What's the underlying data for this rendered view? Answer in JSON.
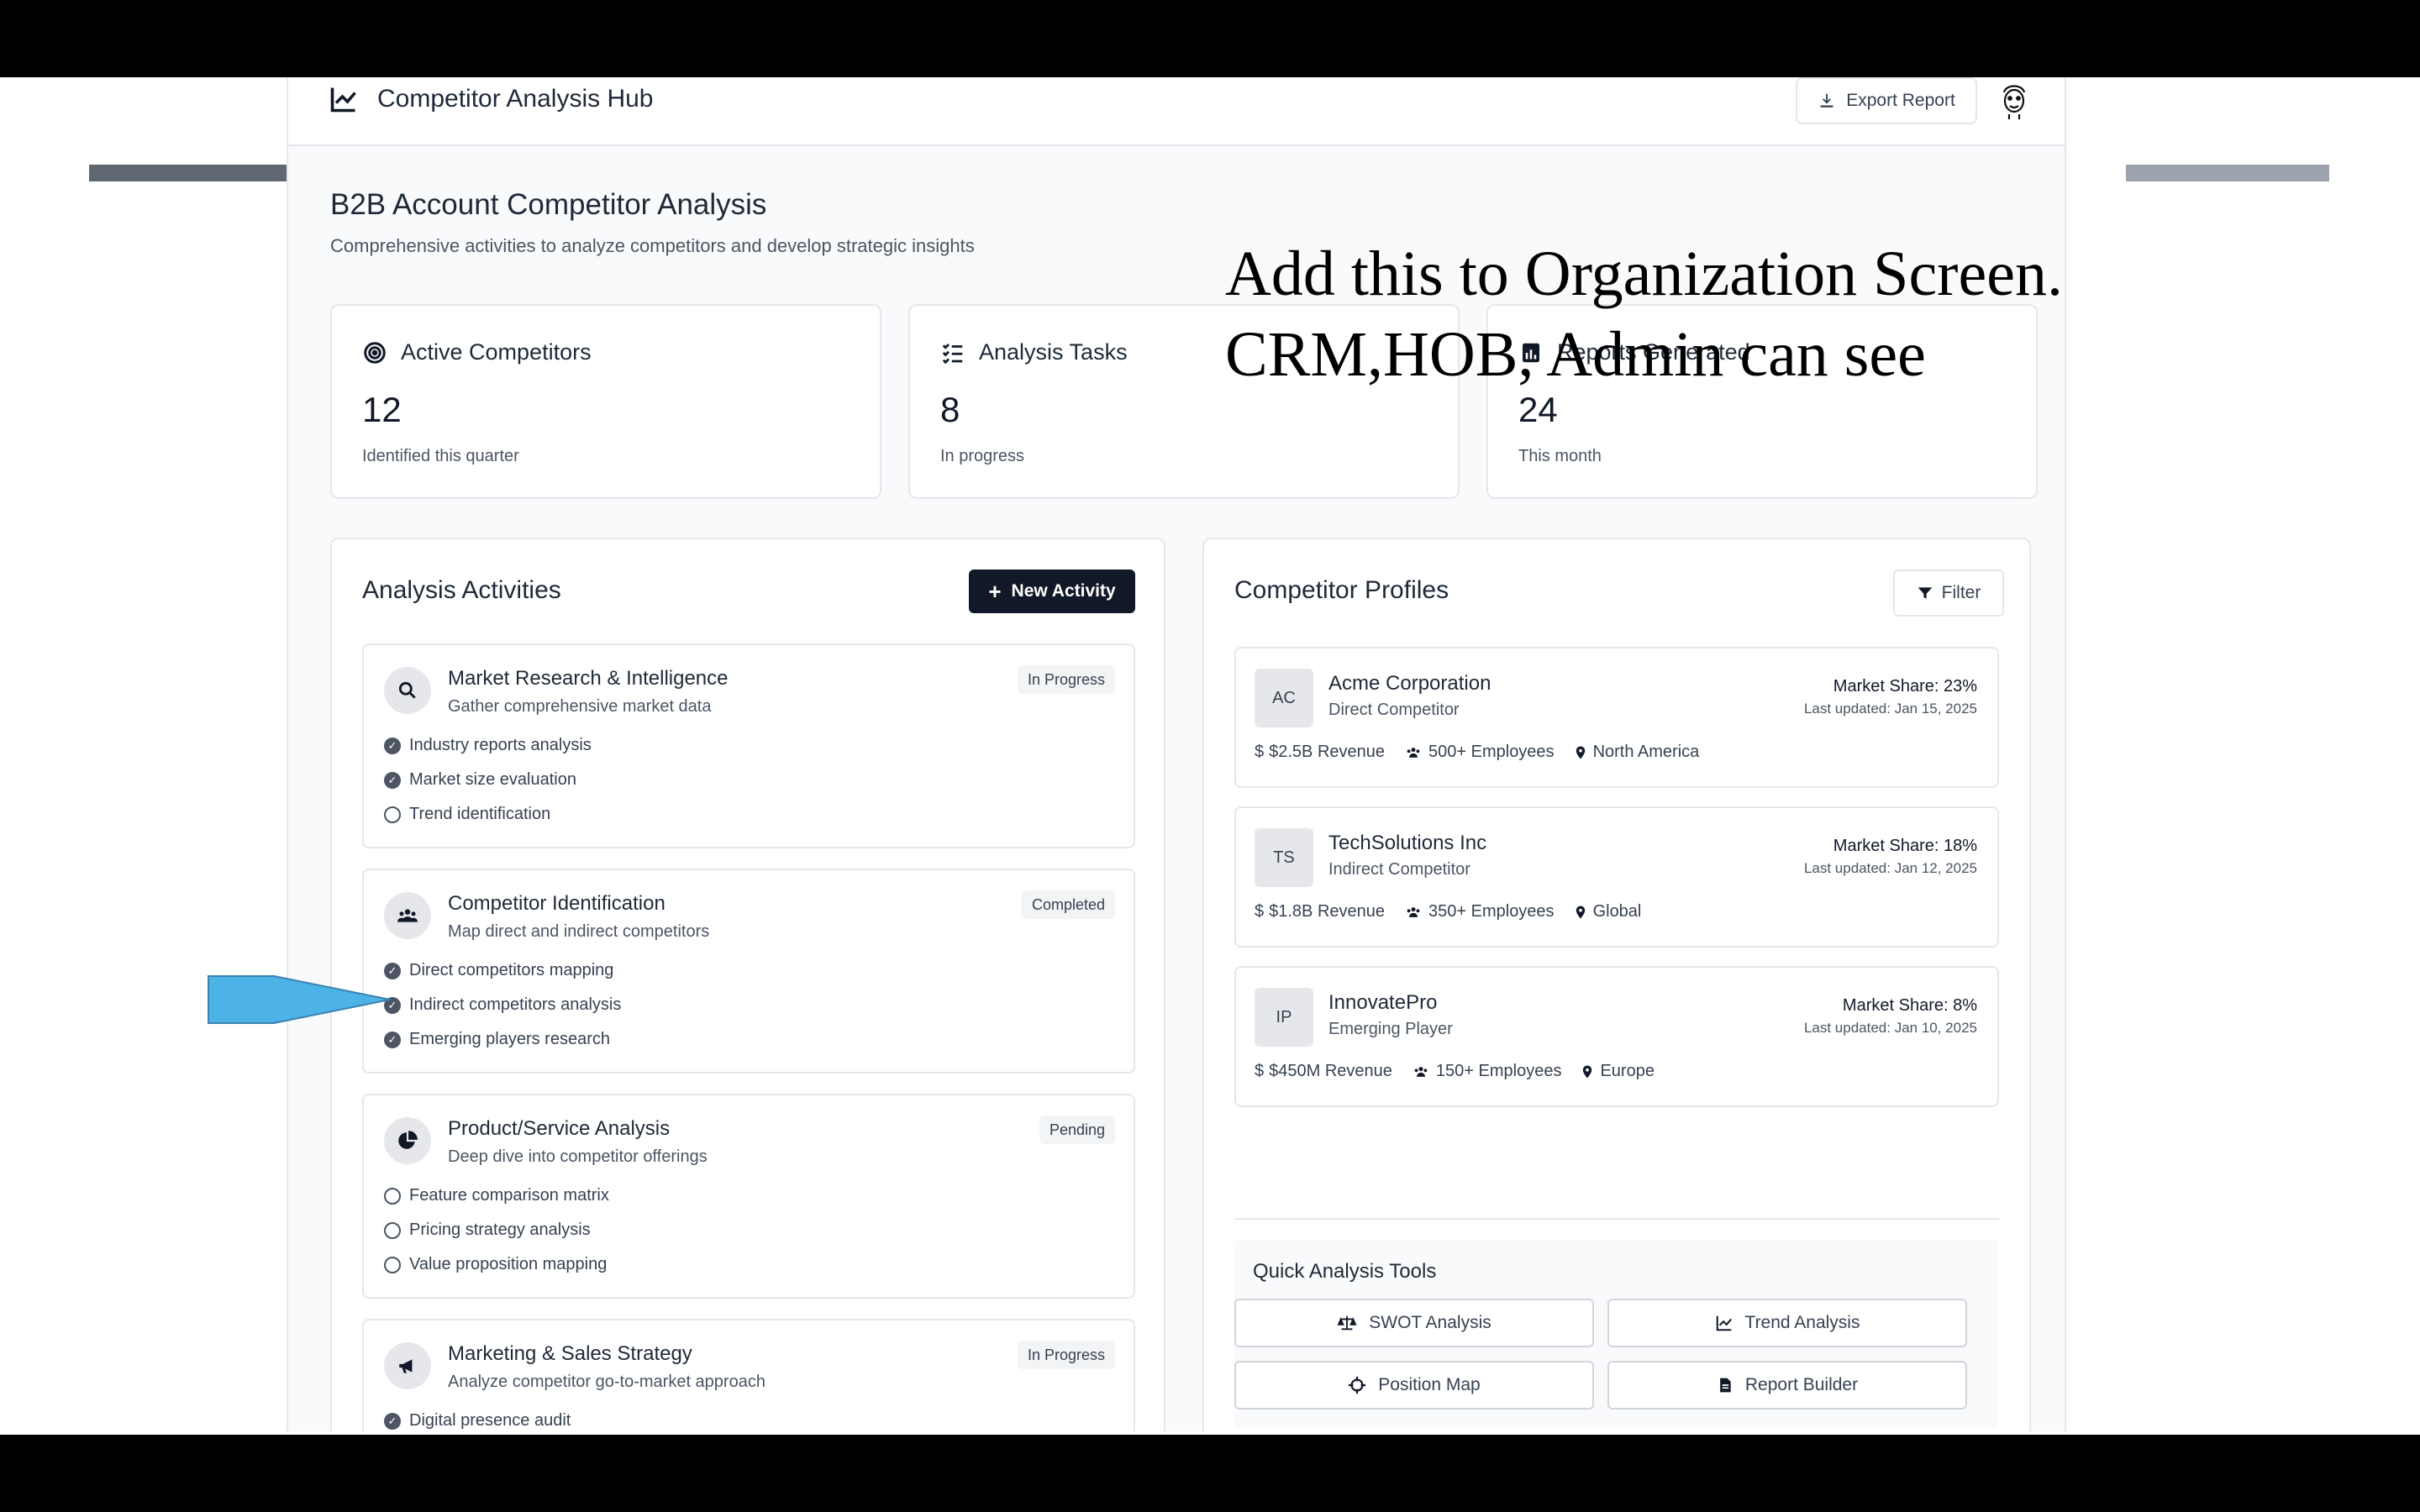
{
  "app": {
    "name": "Competitor Analysis Hub",
    "export_label": "Export Report",
    "title": "B2B Account Competitor Analysis",
    "subtitle": "Comprehensive activities to analyze competitors and develop strategic insights"
  },
  "stats": [
    {
      "label": "Active Competitors",
      "value": "12",
      "note": "Identified this quarter",
      "icon": "target-icon"
    },
    {
      "label": "Analysis Tasks",
      "value": "8",
      "note": "In progress",
      "icon": "list-check-icon"
    },
    {
      "label": "Reports Generated",
      "value": "24",
      "note": "This month",
      "icon": "report-icon"
    }
  ],
  "activities": {
    "title": "Analysis Activities",
    "new_label": "New Activity",
    "items": [
      {
        "title": "Market Research & Intelligence",
        "desc": "Gather comprehensive market data",
        "status": "In Progress",
        "icon": "search-icon",
        "checks": [
          {
            "label": "Industry reports analysis",
            "done": true
          },
          {
            "label": "Market size evaluation",
            "done": true
          },
          {
            "label": "Trend identification",
            "done": false
          }
        ]
      },
      {
        "title": "Competitor Identification",
        "desc": "Map direct and indirect competitors",
        "status": "Completed",
        "icon": "users-icon",
        "checks": [
          {
            "label": "Direct competitors mapping",
            "done": true
          },
          {
            "label": "Indirect competitors analysis",
            "done": true
          },
          {
            "label": "Emerging players research",
            "done": true
          }
        ]
      },
      {
        "title": "Product/Service Analysis",
        "desc": "Deep dive into competitor offerings",
        "status": "Pending",
        "icon": "pie-chart-icon",
        "checks": [
          {
            "label": "Feature comparison matrix",
            "done": false
          },
          {
            "label": "Pricing strategy analysis",
            "done": false
          },
          {
            "label": "Value proposition mapping",
            "done": false
          }
        ]
      },
      {
        "title": "Marketing & Sales Strategy",
        "desc": "Analyze competitor go-to-market approach",
        "status": "In Progress",
        "icon": "megaphone-icon",
        "checks": [
          {
            "label": "Digital presence audit",
            "done": true
          }
        ]
      }
    ]
  },
  "profiles": {
    "title": "Competitor Profiles",
    "filter_label": "Filter",
    "items": [
      {
        "initials": "AC",
        "name": "Acme Corporation",
        "type": "Direct Competitor",
        "share": "Market Share: 23%",
        "updated": "Last updated: Jan 15, 2025",
        "revenue": "$2.5B Revenue",
        "employees": "500+ Employees",
        "region": "North America"
      },
      {
        "initials": "TS",
        "name": "TechSolutions Inc",
        "type": "Indirect Competitor",
        "share": "Market Share: 18%",
        "updated": "Last updated: Jan 12, 2025",
        "revenue": "$1.8B Revenue",
        "employees": "350+ Employees",
        "region": "Global"
      },
      {
        "initials": "IP",
        "name": "InnovatePro",
        "type": "Emerging Player",
        "share": "Market Share: 8%",
        "updated": "Last updated: Jan 10, 2025",
        "revenue": "$450M Revenue",
        "employees": "150+ Employees",
        "region": "Europe"
      }
    ]
  },
  "tools": {
    "title": "Quick Analysis Tools",
    "buttons": [
      {
        "label": "SWOT Analysis",
        "icon": "scale-icon"
      },
      {
        "label": "Trend Analysis",
        "icon": "chart-line-icon"
      },
      {
        "label": "Position Map",
        "icon": "crosshair-icon"
      },
      {
        "label": "Report Builder",
        "icon": "file-icon"
      }
    ]
  },
  "annotation": {
    "line1": "Add this to Organization Screen.",
    "line2": "CRM,HOB, Admin can see"
  }
}
